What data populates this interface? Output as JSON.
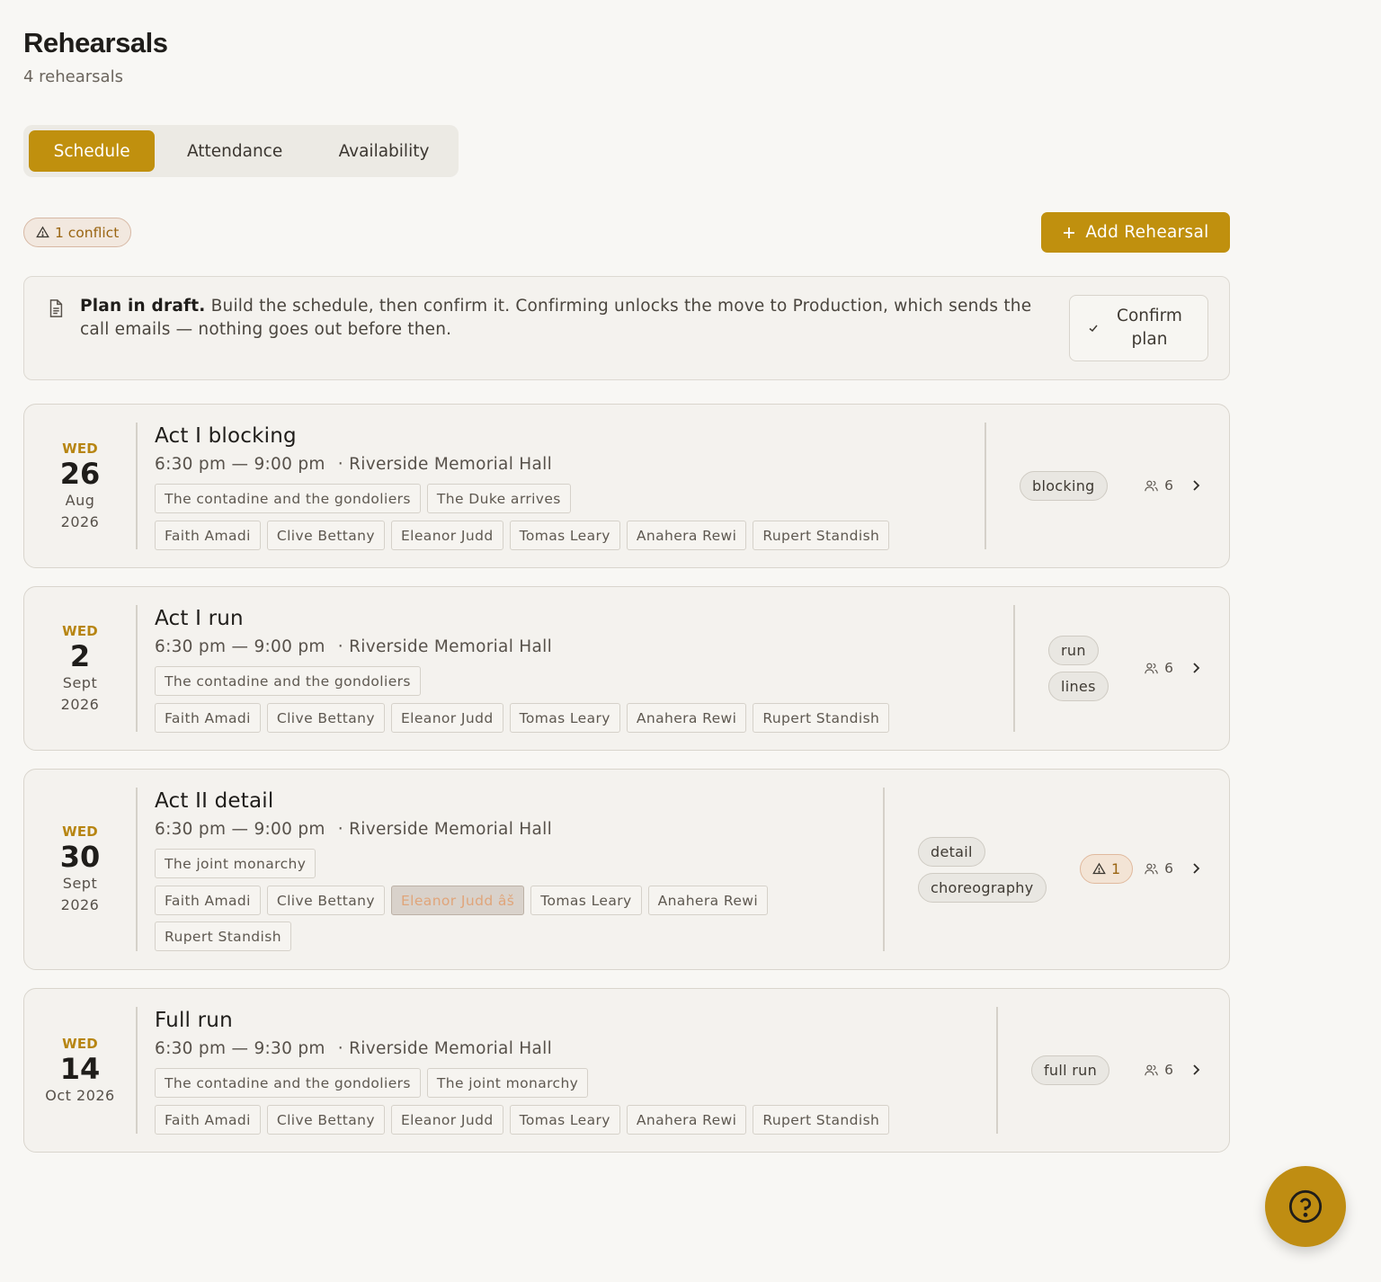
{
  "header": {
    "title": "Rehearsals",
    "subtitle": "4 rehearsals"
  },
  "tabs": [
    {
      "label": "Schedule"
    },
    {
      "label": "Attendance"
    },
    {
      "label": "Availability"
    }
  ],
  "toolbar": {
    "conflict_label": "1 conflict",
    "add_label": "Add Rehearsal"
  },
  "draft": {
    "title": "Plan in draft.",
    "message": "Build the schedule, then confirm it. Confirming unlocks the move to Production, which sends the call emails — nothing goes out before then.",
    "confirm_label": "Confirm plan"
  },
  "rehearsals": [
    {
      "dow": "WED",
      "day": "26",
      "month": "Aug",
      "year": "2026",
      "title": "Act I blocking",
      "time": "6:30 pm — 9:00 pm",
      "venue": "· Riverside Memorial Hall",
      "scenes": [
        "The contadine and the gondoliers",
        "The Duke arrives"
      ],
      "people": [
        "Faith Amadi",
        "Clive Bettany",
        "Eleanor Judd",
        "Tomas Leary",
        "Anahera Rewi",
        "Rupert Standish"
      ],
      "tags": [
        "blocking"
      ],
      "count": "6"
    },
    {
      "dow": "WED",
      "day": "2",
      "month": "Sept",
      "year": "2026",
      "title": "Act I run",
      "time": "6:30 pm — 9:00 pm",
      "venue": "· Riverside Memorial Hall",
      "scenes": [
        "The contadine and the gondoliers"
      ],
      "people": [
        "Faith Amadi",
        "Clive Bettany",
        "Eleanor Judd",
        "Tomas Leary",
        "Anahera Rewi",
        "Rupert Standish"
      ],
      "tags": [
        "run",
        "lines"
      ],
      "count": "6"
    },
    {
      "dow": "WED",
      "day": "30",
      "month": "Sept",
      "year": "2026",
      "title": "Act II detail",
      "time": "6:30 pm — 9:00 pm",
      "venue": "· Riverside Memorial Hall",
      "scenes": [
        "The joint monarchy"
      ],
      "people": [
        "Faith Amadi",
        "Clive Bettany",
        "Eleanor Judd âš",
        "Tomas Leary",
        "Anahera Rewi",
        "Rupert Standish"
      ],
      "tags": [
        "detail",
        "choreography"
      ],
      "count": "6",
      "conflicts": "1"
    },
    {
      "dow": "WED",
      "day": "14",
      "month": "Oct 2026",
      "year": "",
      "title": "Full run",
      "time": "6:30 pm — 9:30 pm",
      "venue": "· Riverside Memorial Hall",
      "scenes": [
        "The contadine and the gondoliers",
        "The joint monarchy"
      ],
      "people": [
        "Faith Amadi",
        "Clive Bettany",
        "Eleanor Judd",
        "Tomas Leary",
        "Anahera Rewi",
        "Rupert Standish"
      ],
      "tags": [
        "full run"
      ],
      "count": "6"
    }
  ],
  "colors": {
    "accent": "#c0900e",
    "warning": "#9a6512",
    "background": "#f8f7f4"
  },
  "icons": {
    "conflict": "warning-triangle-icon",
    "add": "plus-icon",
    "draft": "document-icon",
    "confirm": "check-icon",
    "people": "people-icon",
    "open": "chevron-right-icon",
    "help": "help-circle-icon"
  }
}
